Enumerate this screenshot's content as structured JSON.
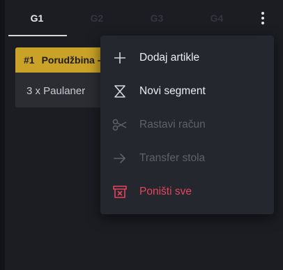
{
  "tabs": [
    {
      "label": "G1",
      "active": true
    },
    {
      "label": "G2",
      "active": false
    },
    {
      "label": "G3",
      "active": false
    },
    {
      "label": "G4",
      "active": false
    }
  ],
  "order": {
    "number": "#1",
    "title": "Porudžbina -",
    "items": [
      "3 x Paulaner"
    ]
  },
  "menu": {
    "items": [
      {
        "label": "Dodaj artikle",
        "icon": "plus-icon",
        "enabled": true
      },
      {
        "label": "Novi segment",
        "icon": "segment-icon",
        "enabled": true
      },
      {
        "label": "Rastavi račun",
        "icon": "scissors-icon",
        "enabled": false
      },
      {
        "label": "Transfer stola",
        "icon": "arrow-right-icon",
        "enabled": false
      },
      {
        "label": "Poništi sve",
        "icon": "cancel-box-icon",
        "enabled": true
      }
    ]
  },
  "colors": {
    "accent": "#c9a227",
    "danger": "#e5455d",
    "background": "#1b1d22",
    "menu_background": "#25272e"
  }
}
